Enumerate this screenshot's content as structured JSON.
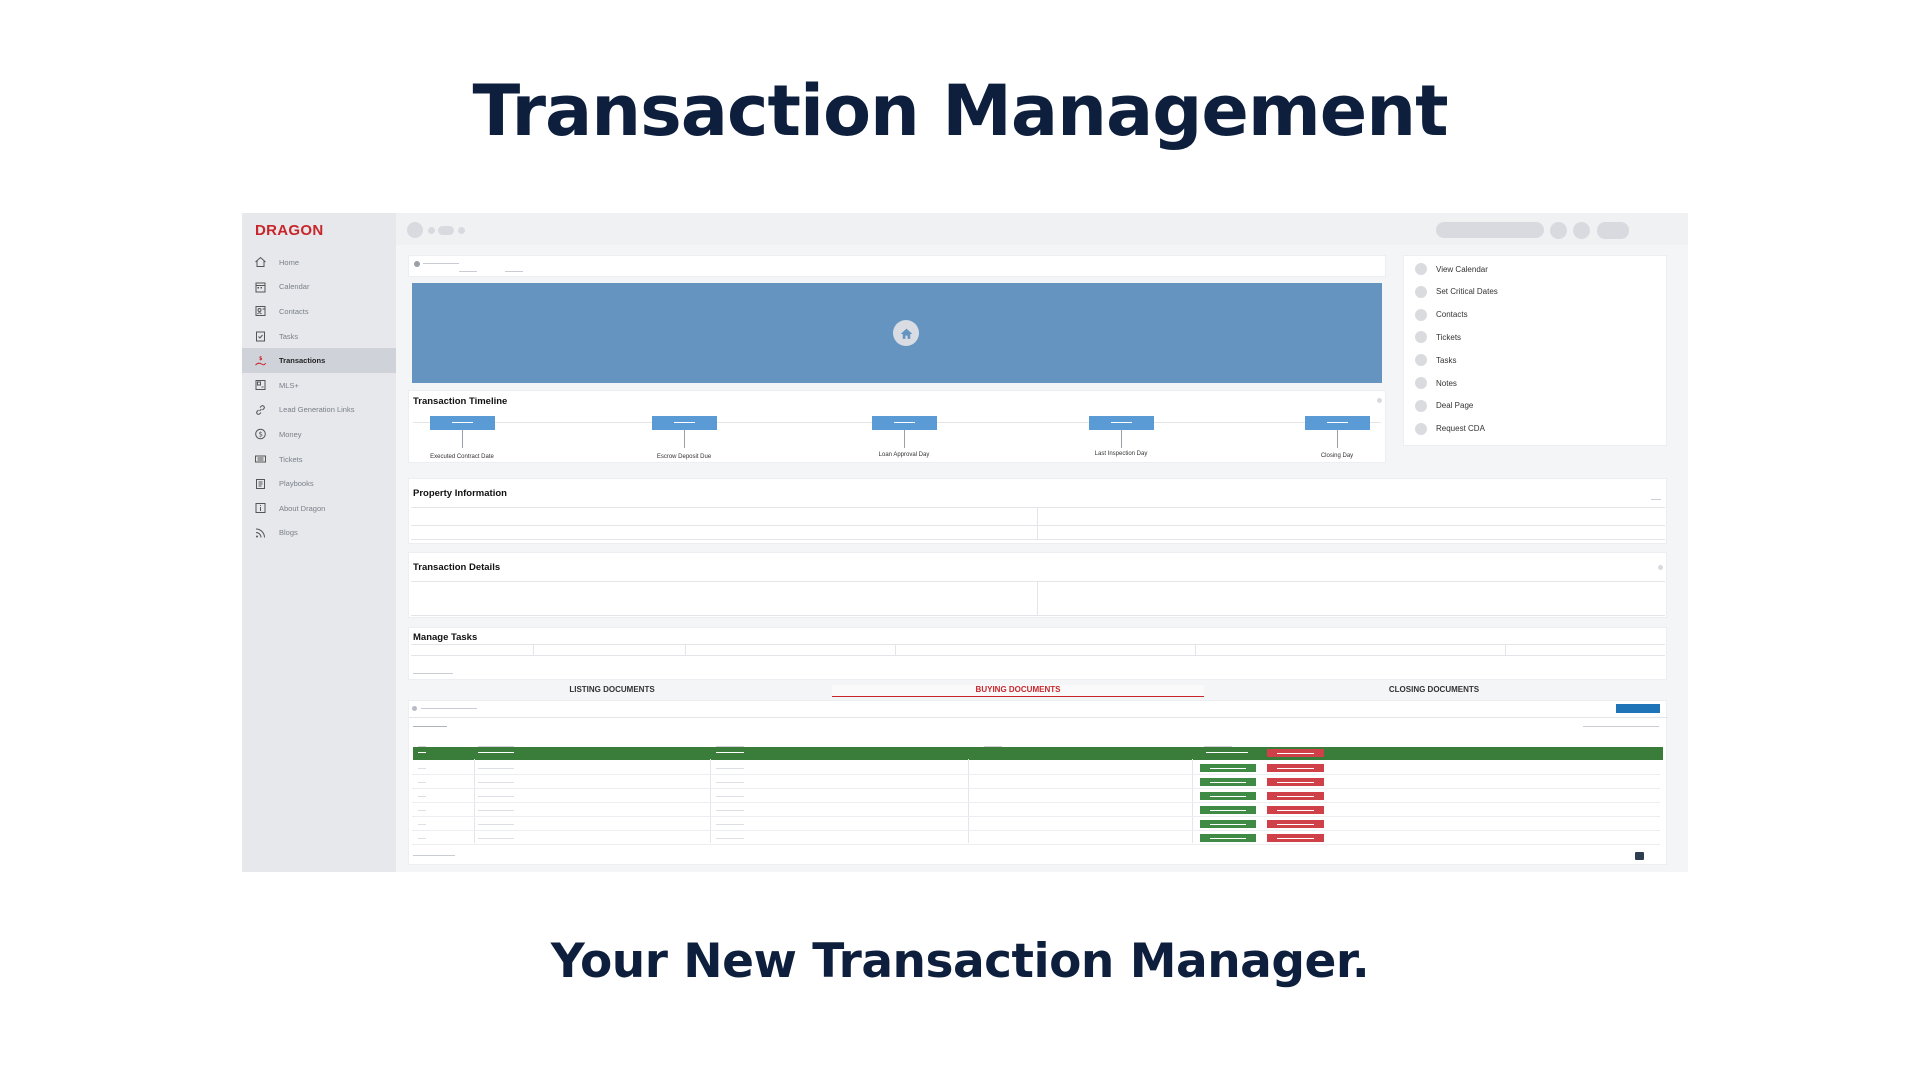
{
  "headline": {
    "title": "Transaction Management",
    "tagline": "Your New Transaction Manager."
  },
  "app": {
    "logo": "DRAGON",
    "sidebar": {
      "items": [
        {
          "label": "Home",
          "icon": "home-icon"
        },
        {
          "label": "Calendar",
          "icon": "calendar-icon"
        },
        {
          "label": "Contacts",
          "icon": "contacts-icon"
        },
        {
          "label": "Tasks",
          "icon": "tasks-icon"
        },
        {
          "label": "Transactions",
          "icon": "transactions-icon",
          "active": true
        },
        {
          "label": "MLS+",
          "icon": "mls-icon"
        },
        {
          "label": "Lead Generation Links",
          "icon": "link-icon"
        },
        {
          "label": "Money",
          "icon": "money-icon"
        },
        {
          "label": "Tickets",
          "icon": "ticket-icon"
        },
        {
          "label": "Playbooks",
          "icon": "playbook-icon"
        },
        {
          "label": "About Dragon",
          "icon": "info-icon"
        },
        {
          "label": "Blogs",
          "icon": "rss-icon"
        }
      ]
    },
    "timeline": {
      "title": "Transaction Timeline",
      "milestones": [
        "Executed Contract Date",
        "Escrow Deposit Due",
        "Loan Approval Day",
        "Last Inspection Day",
        "Closing Day"
      ]
    },
    "quick_actions": [
      "View Calendar",
      "Set Critical Dates",
      "Contacts",
      "Tickets",
      "Tasks",
      "Notes",
      "Deal Page",
      "Request CDA"
    ],
    "sections": {
      "property": "Property Information",
      "details": "Transaction Details",
      "tasks": "Manage Tasks"
    },
    "document_tabs": [
      {
        "label": "LISTING DOCUMENTS"
      },
      {
        "label": "BUYING DOCUMENTS",
        "active": true
      },
      {
        "label": "CLOSING DOCUMENTS"
      }
    ],
    "colors": {
      "brand_red": "#c8262b",
      "banner_blue": "#6594c1",
      "timeline_blue": "#5b9bd5",
      "table_header_green": "#3a7d3a",
      "approve_green": "#3f8a44",
      "reject_red": "#d04048",
      "title_navy": "#0d1f3c"
    }
  }
}
